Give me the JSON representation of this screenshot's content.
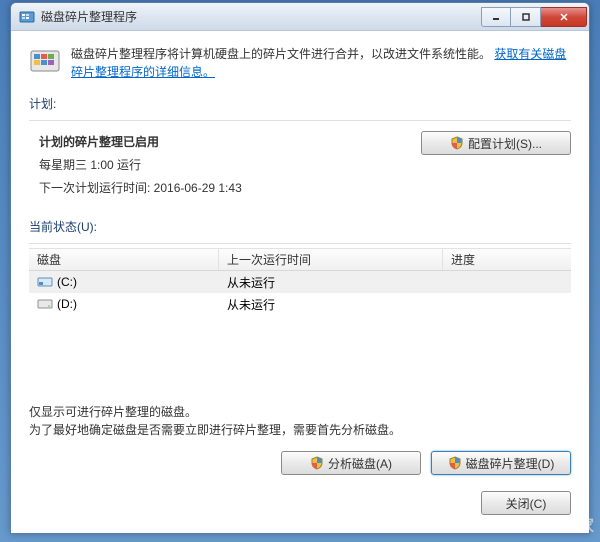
{
  "window": {
    "title": "磁盘碎片整理程序"
  },
  "banner": {
    "text": "磁盘碎片整理程序将计算机硬盘上的碎片文件进行合并，以改进文件系统性能。",
    "link": "获取有关磁盘碎片整理程序的详细信息。"
  },
  "schedule": {
    "section_label": "计划:",
    "title": "计划的碎片整理已启用",
    "frequency": "每星期三  1:00 运行",
    "next_run": "下一次计划运行时间: 2016-06-29 1:43",
    "config_btn": "配置计划(S)..."
  },
  "status": {
    "section_label": "当前状态(U):"
  },
  "table": {
    "headers": {
      "disk": "磁盘",
      "last": "上一次运行时间",
      "prog": "进度"
    },
    "rows": [
      {
        "label": "(C:)",
        "last": "从未运行",
        "prog": "",
        "type": "system"
      },
      {
        "label": "(D:)",
        "last": "从未运行",
        "prog": "",
        "type": "local"
      }
    ]
  },
  "notes": {
    "line1": "仅显示可进行碎片整理的磁盘。",
    "line2": "为了最好地确定磁盘是否需要立即进行碎片整理，需要首先分析磁盘。"
  },
  "actions": {
    "analyze": "分析磁盘(A)",
    "defrag": "磁盘碎片整理(D)"
  },
  "footer": {
    "close": "关闭(C)"
  },
  "watermark": "系统之家"
}
